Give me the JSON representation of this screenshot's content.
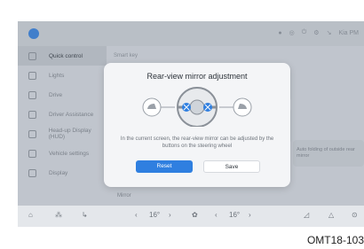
{
  "sidebar": {
    "items": [
      {
        "label": "Quick control",
        "active": true
      },
      {
        "label": "Lights",
        "active": false
      },
      {
        "label": "Drive",
        "active": false
      },
      {
        "label": "Driver Assistance",
        "active": false
      },
      {
        "label": "Head-up Display (HUD)",
        "active": false
      },
      {
        "label": "Vehicle settings",
        "active": false
      },
      {
        "label": "Display",
        "active": false
      }
    ]
  },
  "content": {
    "section_title": "Smart key",
    "side_note": "Auto folding of outside rear mirror",
    "mirror_label": "Mirror"
  },
  "status": {
    "user": "Kia PM"
  },
  "dialog": {
    "title": "Rear-view mirror adjustment",
    "description": "In the current screen, the rear-view mirror can be adjusted by the buttons on the steering wheel",
    "reset_label": "Reset",
    "save_label": "Save"
  },
  "bottom": {
    "temp_left": "16°",
    "temp_right": "16°"
  },
  "caption": "OMT18-103",
  "colors": {
    "accent": "#2f7fe0"
  }
}
